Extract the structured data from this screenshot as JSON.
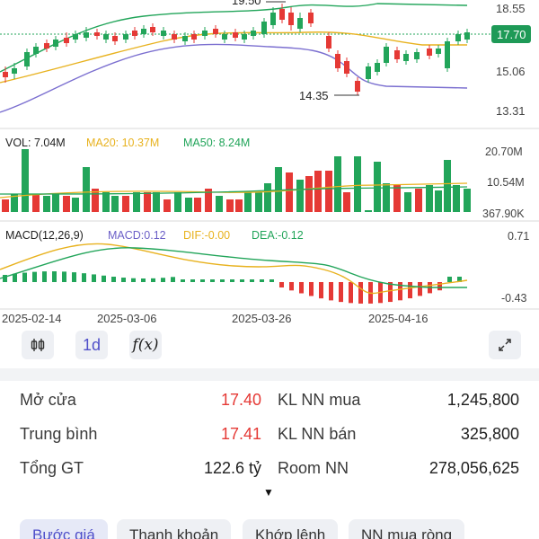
{
  "price_chart": {
    "axis_labels": [
      "18.55",
      "17.70",
      "15.06",
      "13.31"
    ],
    "current_price": "17.70",
    "high_marker": "19.50",
    "low_marker": "14.35",
    "colors": {
      "up": "#22a55a",
      "down": "#e53935",
      "ma_yellow": "#e8b21f",
      "band_green": "#22a55a",
      "band_purple": "#7b6fd0",
      "current_price_bg": "#1e9a57"
    }
  },
  "volume_panel": {
    "vol_label": "VOL: 7.04M",
    "ma20_label": "MA20: 10.37M",
    "ma50_label": "MA50: 8.24M",
    "axis_labels": [
      "20.70M",
      "10.54M",
      "367.90K"
    ]
  },
  "macd_panel": {
    "title": "MACD(12,26,9)",
    "macd_label": "MACD:0.12",
    "dif_label": "DIF:-0.00",
    "dea_label": "DEA:-0.12",
    "axis_labels": [
      "0.71",
      "-0.43"
    ]
  },
  "date_labels": [
    "2025-02-14",
    "2025-03-06",
    "2025-03-26",
    "2025-04-16"
  ],
  "toolbar": {
    "candle_icon": "candlestick-icon",
    "period_label": "1d",
    "fx_label": "f(x)",
    "expand_icon": "expand-icon"
  },
  "stats": {
    "open_label": "Mở cửa",
    "open_value": "17.40",
    "avg_label": "Trung bình",
    "avg_value": "17.41",
    "total_label": "Tổng GT",
    "total_value": "122.6 tỷ",
    "nn_buy_label": "KL NN mua",
    "nn_buy_value": "1,245,800",
    "nn_sell_label": "KL NN bán",
    "nn_sell_value": "325,800",
    "room_label": "Room NN",
    "room_value": "278,056,625"
  },
  "more_arrow": "▼",
  "tabs": [
    "Bước giá",
    "Thanh khoản",
    "Khớp lệnh",
    "NN mua ròng"
  ]
}
